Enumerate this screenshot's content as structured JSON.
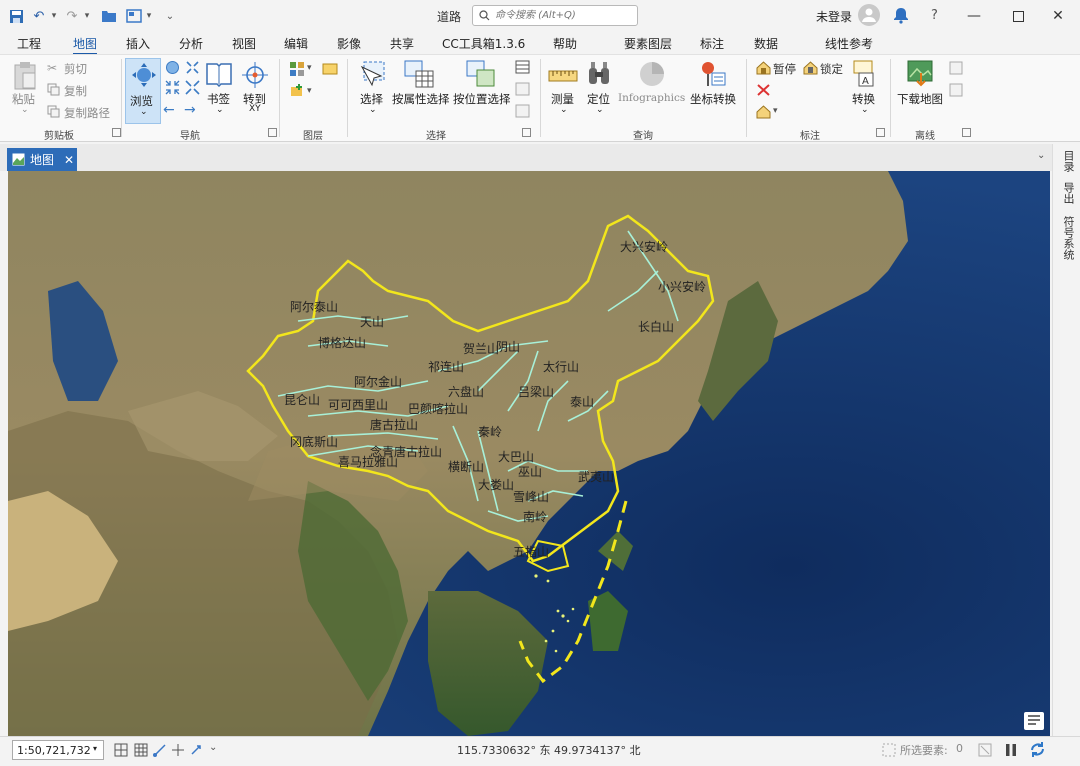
{
  "titlebar": {
    "app_title": "道路",
    "search_placeholder": "命令搜索 (Alt+Q)",
    "user_label": "未登录"
  },
  "tabs": {
    "project": "工程",
    "map": "地图",
    "insert": "插入",
    "analysis": "分析",
    "view": "视图",
    "edit": "编辑",
    "imagery": "影像",
    "share": "共享",
    "cc_toolbox": "CC工具箱1.3.6",
    "help": "帮助",
    "feature_layer": "要素图层",
    "labeling": "标注",
    "data": "数据",
    "line_symbology": "线性参考"
  },
  "ribbon": {
    "clipboard": {
      "paste": "粘贴",
      "cut": "剪切",
      "copy": "复制",
      "copy_path": "复制路径",
      "group": "剪贴板"
    },
    "navigate": {
      "explore": "浏览",
      "bookmarks": "书签",
      "goto": "转到",
      "goto_sub": "XY",
      "group": "导航"
    },
    "layer": {
      "group": "图层"
    },
    "selection": {
      "select": "选择",
      "by_attr": "按属性选择",
      "by_location": "按位置选择",
      "group": "选择"
    },
    "inquiry": {
      "measure": "测量",
      "locate": "定位",
      "infographics": "Infographics",
      "coord_convert": "坐标转换",
      "group": "查询"
    },
    "labeling": {
      "pause": "暂停",
      "lock": "锁定",
      "convert": "转换",
      "group": "标注"
    },
    "offline": {
      "download": "下载地图",
      "group": "离线"
    }
  },
  "pane": {
    "map_tab": "地图"
  },
  "side_panel": {
    "catalog": "目录",
    "navigate": "导出",
    "symbology": "符号系统"
  },
  "statusbar": {
    "scale": "1:50,721,732",
    "coordinates": "115.7330632° 东  49.9734137° 北",
    "selected_label": "所选要素:",
    "selected_count": "0"
  },
  "map": {
    "mountain_labels": [
      "天山",
      "阿尔泰山",
      "博格达山",
      "阿尔金山",
      "昆仑山",
      "可可西里山",
      "巴颜喀拉山",
      "唐古拉山",
      "冈底斯山",
      "喜马拉雅山",
      "祁连山",
      "阴山",
      "大兴安岭",
      "小兴安岭",
      "长白山",
      "太行山",
      "秦岭",
      "大巴山",
      "巫山",
      "雪峰山",
      "武夷山",
      "南岭",
      "横断山",
      "六盘山",
      "贺兰山",
      "吕梁山",
      "泰山",
      "五指山",
      "念青唐古拉山",
      "大娄山"
    ],
    "colors": {
      "ocean": "#1b3a6e",
      "land": "#8a7d5a",
      "boundary": "#f2e61c",
      "mountain_line": "#a8f0d8"
    }
  }
}
